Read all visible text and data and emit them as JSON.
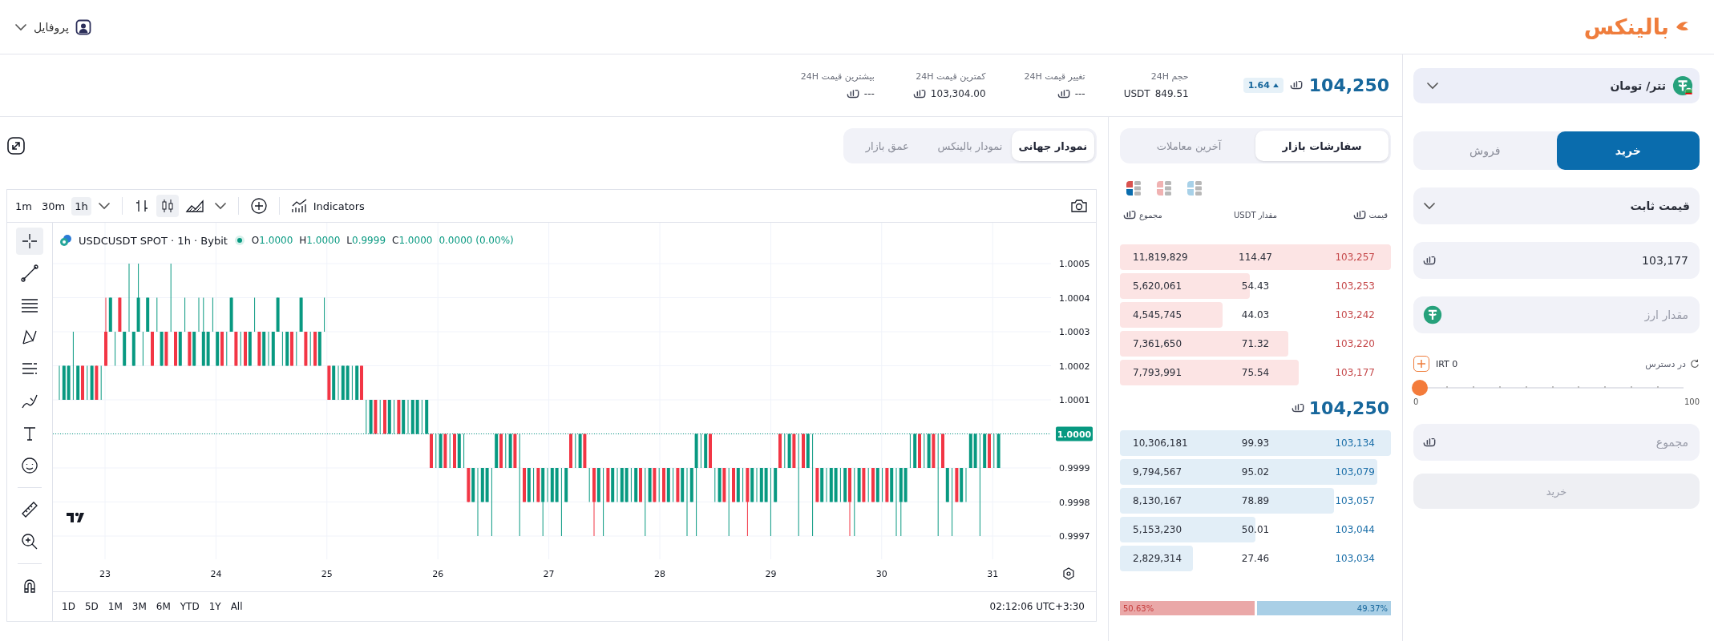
{
  "header": {
    "logo": "بالینکس",
    "profile": "پروفایل"
  },
  "pair": {
    "name": "تتر/ تومان"
  },
  "ticker": {
    "price": "104,250",
    "change": "1.64"
  },
  "stats": {
    "volume_24h": {
      "label": "حجم 24H",
      "value": "849.51",
      "unit": "USDT"
    },
    "change_24h": {
      "label": "تغییر قیمت 24H",
      "value": "---"
    },
    "low_24h": {
      "label": "کمترین قیمت 24H",
      "value": "103,304.00"
    },
    "high_24h": {
      "label": "بیشترین قیمت 24H",
      "value": "---"
    }
  },
  "chart_tabs": [
    {
      "label": "نمودار جهانی",
      "selected": true
    },
    {
      "label": "نمودار بالینکس",
      "selected": false
    },
    {
      "label": "عمق بازار",
      "selected": false
    }
  ],
  "chart": {
    "intervals": [
      {
        "label": "1m",
        "selected": false
      },
      {
        "label": "30m",
        "selected": false
      },
      {
        "label": "1h",
        "selected": true
      }
    ],
    "indicators": "Indicators",
    "symbol": "USDCUSDT SPOT · 1h · Bybit",
    "ohlc": [
      {
        "key": "O",
        "value": "1.0000"
      },
      {
        "key": "H",
        "value": "1.0000"
      },
      {
        "key": "L",
        "value": "0.9999"
      },
      {
        "key": "C",
        "value": "1.0000"
      }
    ],
    "change": "0.0000 (0.00%)",
    "price_ticks": [
      {
        "label": "1.0005",
        "current": false
      },
      {
        "label": "1.0004",
        "current": false
      },
      {
        "label": "1.0003",
        "current": false
      },
      {
        "label": "1.0002",
        "current": false
      },
      {
        "label": "1.0001",
        "current": false
      },
      {
        "label": "1.0000",
        "current": true
      },
      {
        "label": "0.9999",
        "current": false
      },
      {
        "label": "0.9998",
        "current": false
      },
      {
        "label": "0.9997",
        "current": false
      }
    ],
    "date_ticks": [
      "23",
      "24",
      "25",
      "26",
      "27",
      "28",
      "29",
      "30",
      "31"
    ],
    "ranges": [
      "1D",
      "5D",
      "1M",
      "3M",
      "6M",
      "YTD",
      "1Y",
      "All"
    ],
    "time": "02:12:06 UTC+3:30"
  },
  "orderbook": {
    "tabs": [
      {
        "label": "سفارشات بازار",
        "selected": true
      },
      {
        "label": "آخرین معاملات",
        "selected": false
      }
    ],
    "columns": [
      {
        "label": "قیمت",
        "unit_icon": true
      },
      {
        "label": "مقدار USDT",
        "unit_icon": false
      },
      {
        "label": "مجموع",
        "unit_icon": true
      }
    ],
    "asks": [
      {
        "price": "103,257",
        "amount": "114.47",
        "total": "11,819,829",
        "level": 1.0
      },
      {
        "price": "103,253",
        "amount": "54.43",
        "total": "5,620,061",
        "level": 0.48
      },
      {
        "price": "103,242",
        "amount": "44.03",
        "total": "4,545,745",
        "level": 0.38
      },
      {
        "price": "103,220",
        "amount": "71.32",
        "total": "7,361,650",
        "level": 0.62
      },
      {
        "price": "103,177",
        "amount": "75.54",
        "total": "7,793,991",
        "level": 0.66
      }
    ],
    "last_price": "104,250",
    "bids": [
      {
        "price": "103,134",
        "amount": "99.93",
        "total": "10,306,181",
        "level": 1.0
      },
      {
        "price": "103,079",
        "amount": "95.02",
        "total": "9,794,567",
        "level": 0.95
      },
      {
        "price": "103,057",
        "amount": "78.89",
        "total": "8,130,167",
        "level": 0.79
      },
      {
        "price": "103,044",
        "amount": "50.01",
        "total": "5,153,230",
        "level": 0.5
      },
      {
        "price": "103,034",
        "amount": "27.46",
        "total": "2,829,314",
        "level": 0.27
      }
    ],
    "balance": {
      "sell_share": "50.63%",
      "buy_share": "49.37%",
      "level": 0.5063
    }
  },
  "order_form": {
    "sides": [
      {
        "label": "خرید",
        "selected": true
      },
      {
        "label": "فروش",
        "selected": false
      }
    ],
    "order_type": "قیمت ثابت",
    "price": "103,177",
    "amount_placeholder": "مقدار ارز",
    "available_label": "در دسترس",
    "available": "0 IRT",
    "slider": {
      "level": 0,
      "min": "0",
      "max": "100"
    },
    "total_placeholder": "مجموع",
    "submit": {
      "label": "خرید",
      "disabled": true
    }
  }
}
